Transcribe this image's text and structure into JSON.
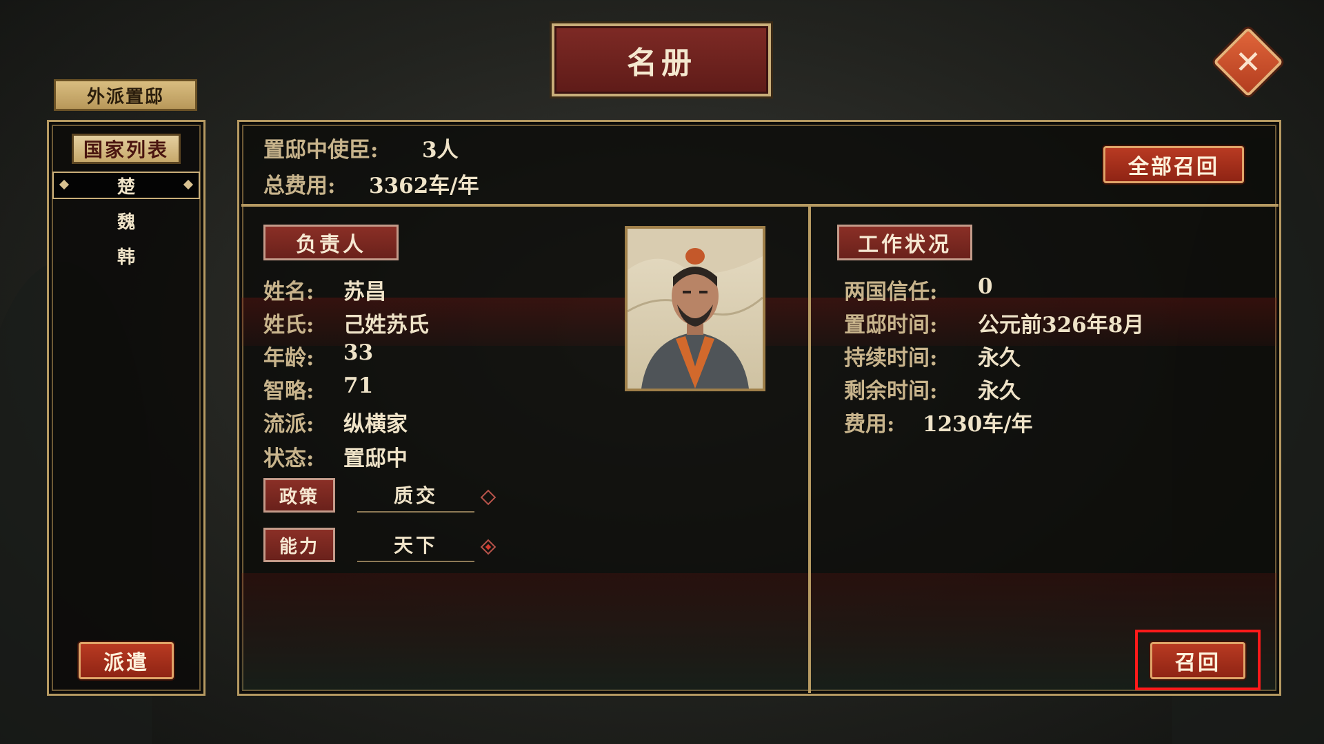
{
  "title": "名册",
  "close_icon": "✕",
  "left": {
    "tab_label": "外派置邸",
    "list_header": "国家列表",
    "countries": [
      "楚",
      "魏",
      "韩"
    ],
    "selected_index": 0,
    "dispatch_label": "派遣"
  },
  "summary": {
    "envoys_label": "置邸中使臣:",
    "envoys_value": "3人",
    "cost_label": "总费用:",
    "cost_value": "3362车/年",
    "recall_all_label": "全部召回"
  },
  "person": {
    "header": "负责人",
    "rows": [
      {
        "label": "姓名:",
        "value": "苏昌"
      },
      {
        "label": "姓氏:",
        "value": "己姓苏氏"
      },
      {
        "label": "年龄:",
        "value": "33"
      },
      {
        "label": "智略:",
        "value": "71"
      },
      {
        "label": "流派:",
        "value": "纵横家"
      },
      {
        "label": "状态:",
        "value": "置邸中"
      }
    ],
    "policy_label": "政策",
    "policy_value": "质交",
    "ability_label": "能力",
    "ability_value": "天下"
  },
  "work": {
    "header": "工作状况",
    "rows": [
      {
        "label": "两国信任:",
        "value": "0"
      },
      {
        "label": "置邸时间:",
        "value": "公元前326年8月"
      },
      {
        "label": "持续时间:",
        "value": "永久"
      },
      {
        "label": "剩余时间:",
        "value": "永久"
      },
      {
        "label": "费用:",
        "value": "1230车/年"
      }
    ],
    "recall_label": "召回"
  },
  "colors": {
    "accent_red": "#8a2f26",
    "gold_border": "#b69a62",
    "highlight": "#ff1a1a"
  }
}
